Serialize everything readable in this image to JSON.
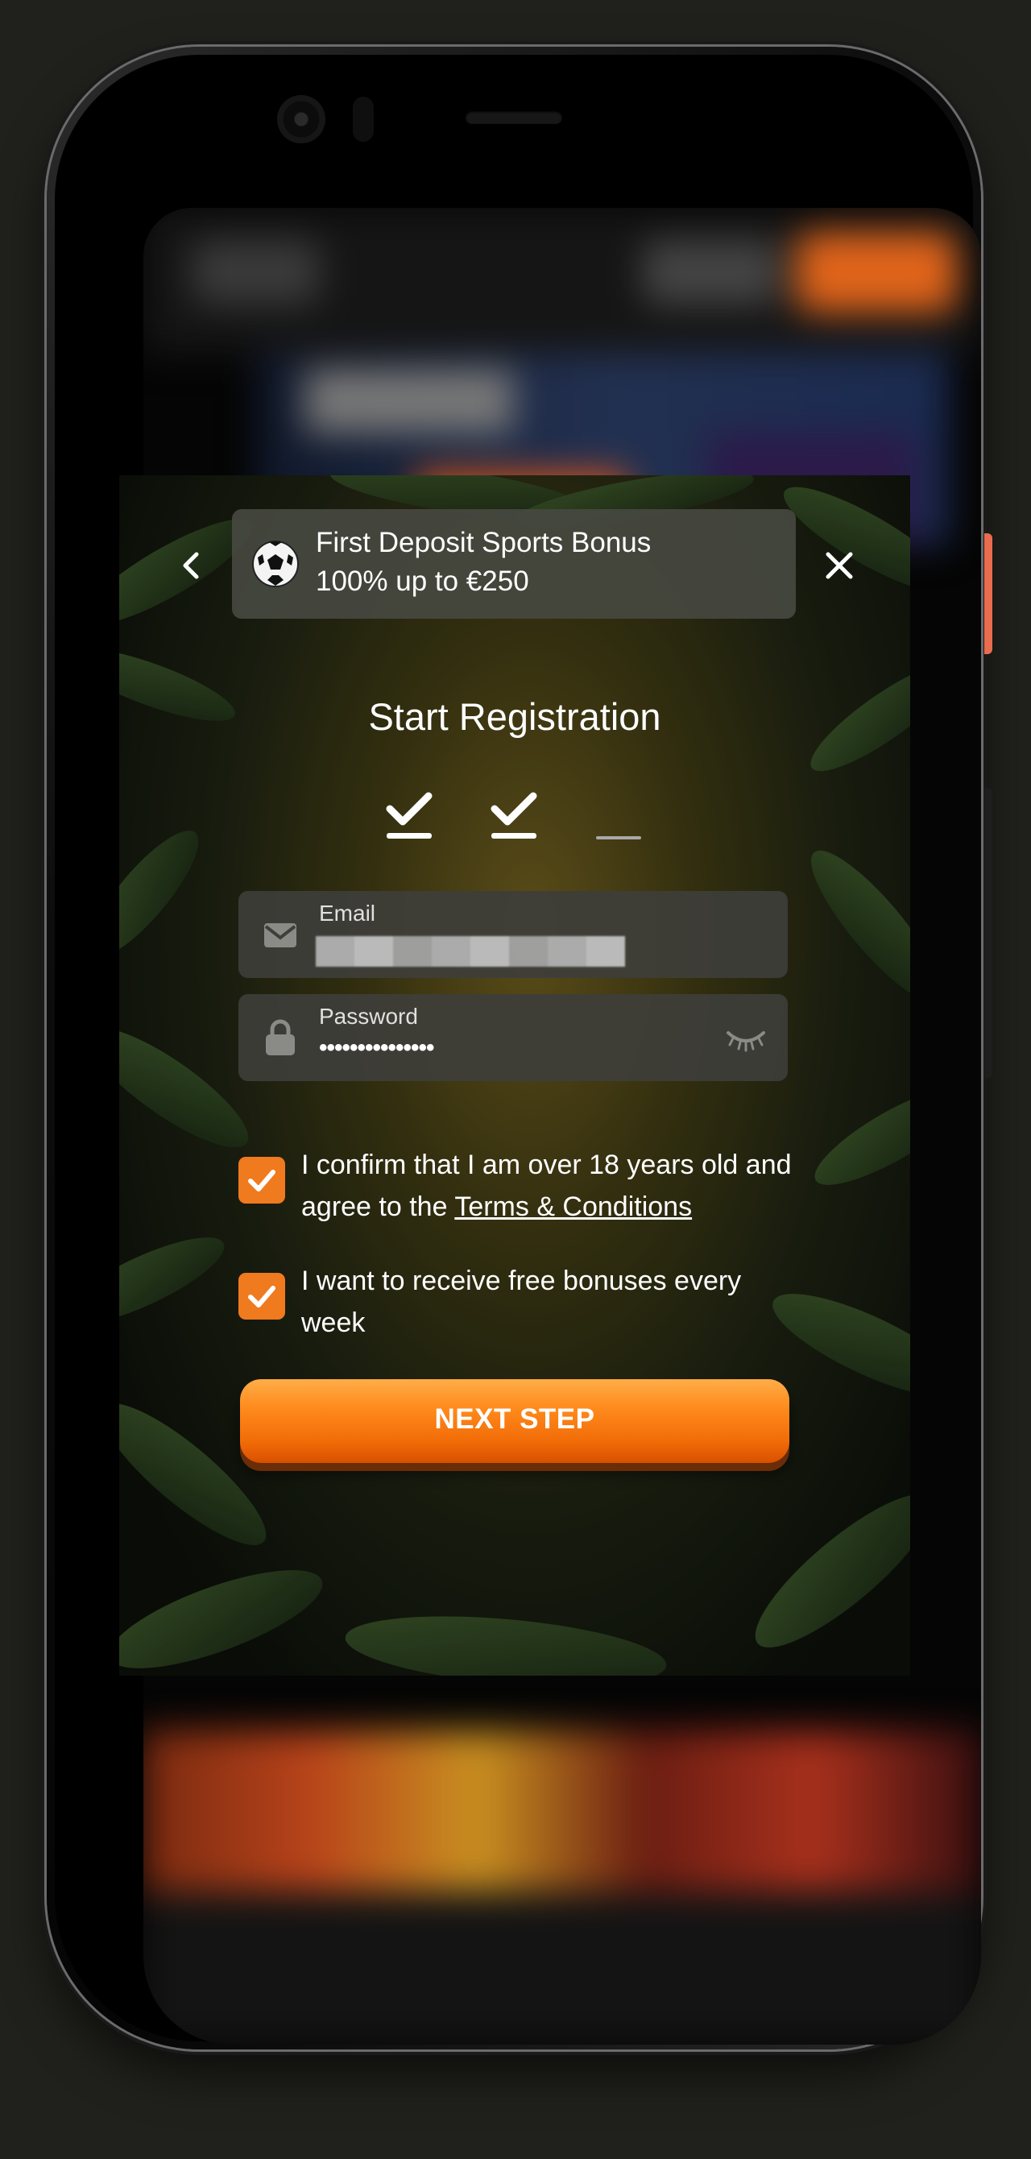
{
  "promo": {
    "icon": "soccer-ball-icon",
    "line1": "First Deposit Sports Bonus",
    "line2": "100% up to €250"
  },
  "title": "Start Registration",
  "steps": [
    {
      "state": "completed"
    },
    {
      "state": "completed"
    },
    {
      "state": "current"
    }
  ],
  "fields": {
    "email": {
      "label": "Email",
      "value_obscured": true
    },
    "password": {
      "label": "Password",
      "value": "•••••••••••••••"
    }
  },
  "checkboxes": {
    "age": {
      "checked": true,
      "text": "I confirm that I am over 18 years old and agree to the ",
      "link": "Terms & Conditions"
    },
    "bonuses": {
      "checked": true,
      "text": "I want to receive free bonuses every week"
    }
  },
  "next_button": "NEXT STEP",
  "colors": {
    "accent": "#f07a1e",
    "button_top": "#ffad48",
    "button_bottom": "#d85000",
    "field_bg": "#3e3e3a",
    "phone_side_button": "#e96c4f"
  }
}
